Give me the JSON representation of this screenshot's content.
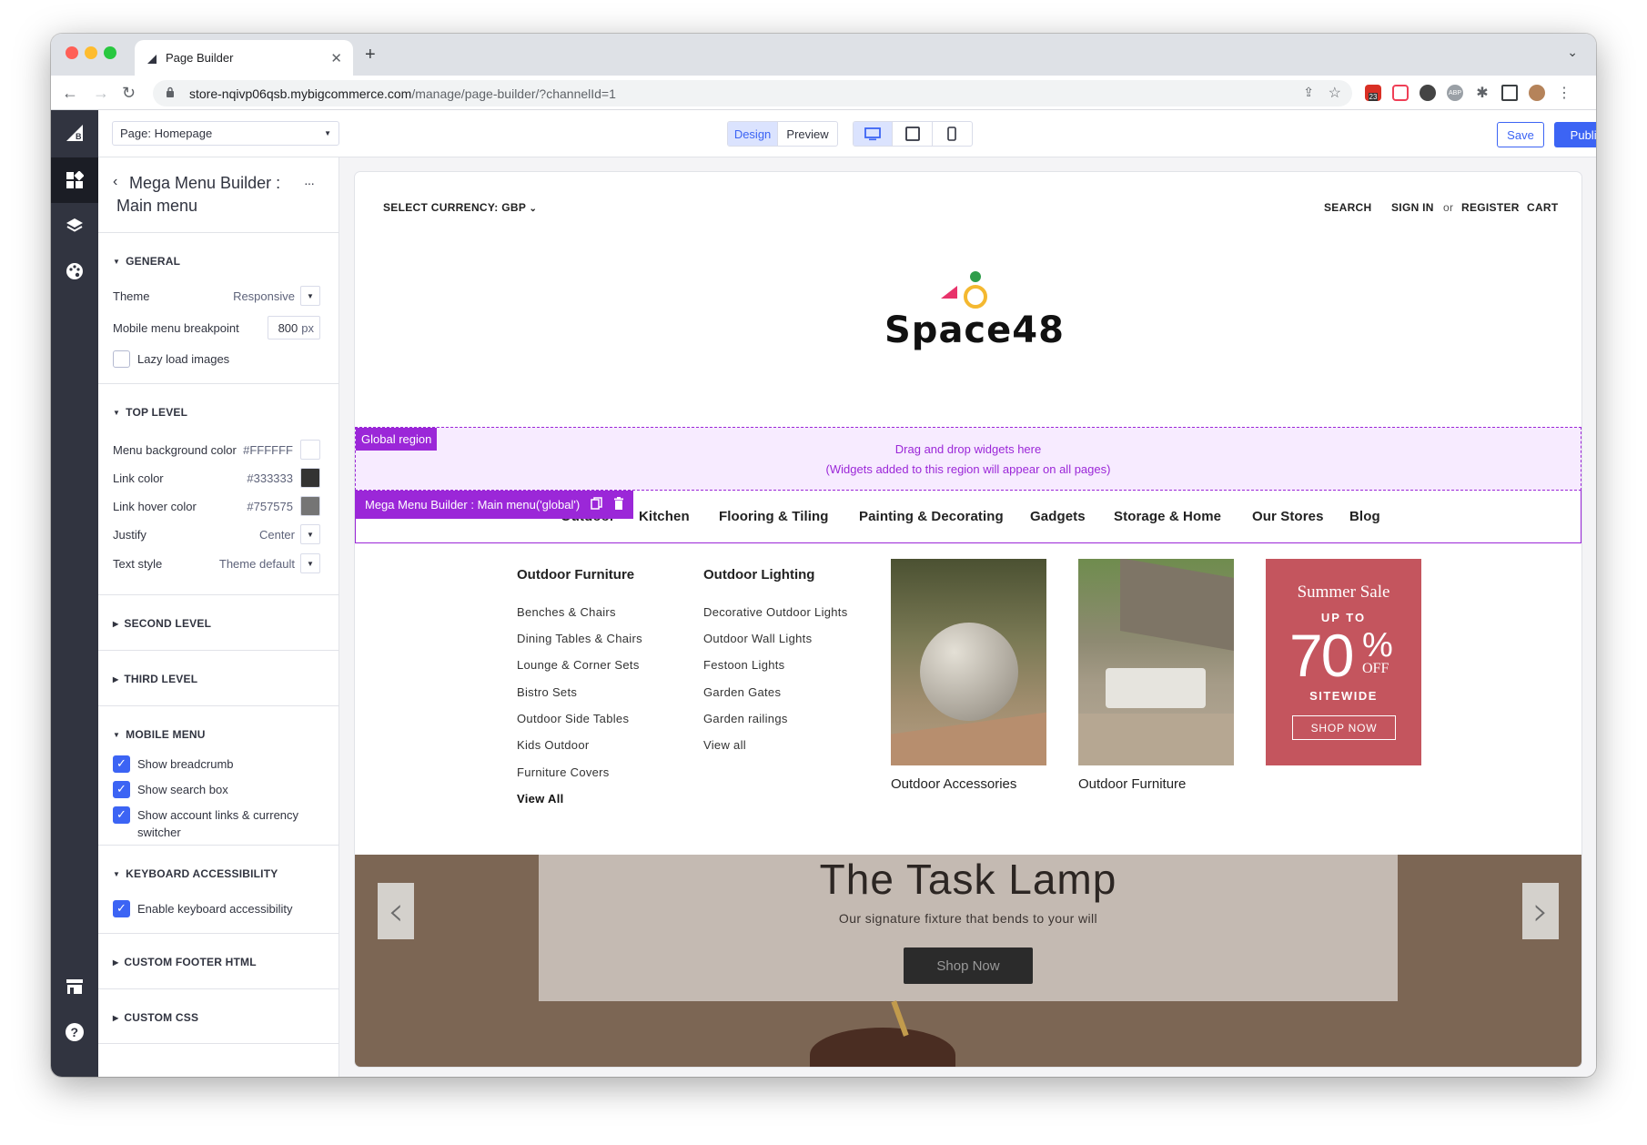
{
  "browser": {
    "tab_title": "Page Builder",
    "url_host": "store-nqivp06qsb.mybigcommerce.com",
    "url_path": "/manage/page-builder/?channelId=1",
    "extension_badge": "23",
    "extension_abp": "ABP"
  },
  "topbar": {
    "page_select": "Page: Homepage",
    "mode_design": "Design",
    "mode_preview": "Preview",
    "save_label": "Save",
    "publish_label": "Publish",
    "accent": "#3c64f4"
  },
  "panel": {
    "back_title_line1": "Mega Menu Builder :",
    "back_title_line2": "Main menu",
    "more": "···",
    "general": {
      "heading": "GENERAL",
      "theme_label": "Theme",
      "theme_value": "Responsive",
      "breakpoint_label": "Mobile menu breakpoint",
      "breakpoint_value": "800",
      "breakpoint_unit": "px",
      "lazy_label": "Lazy load images",
      "lazy_checked": false
    },
    "top_level": {
      "heading": "TOP LEVEL",
      "bg_label": "Menu background color",
      "bg_value": "#FFFFFF",
      "link_label": "Link color",
      "link_value": "#333333",
      "hover_label": "Link hover color",
      "hover_value": "#757575",
      "justify_label": "Justify",
      "justify_value": "Center",
      "text_label": "Text style",
      "text_value": "Theme default"
    },
    "second_level": "SECOND LEVEL",
    "third_level": "THIRD LEVEL",
    "mobile_menu": {
      "heading": "MOBILE MENU",
      "breadcrumb": "Show breadcrumb",
      "search": "Show search box",
      "account_line1": "Show account links & currency",
      "account_line2": "switcher"
    },
    "keyboard": {
      "heading": "KEYBOARD ACCESSIBILITY",
      "enable": "Enable keyboard accessibility"
    },
    "custom_footer": "CUSTOM FOOTER HTML",
    "custom_css": "CUSTOM CSS"
  },
  "store": {
    "currency": "SELECT CURRENCY: GBP",
    "search": "SEARCH",
    "sign_in": "SIGN IN",
    "or": "or",
    "register": "REGISTER",
    "cart": "CART",
    "logo_text": "Space48",
    "global_region_tag": "Global region",
    "global_line1": "Drag and drop widgets here",
    "global_line2": "(Widgets added to this region will appear on all pages)",
    "mega_tag": "Mega Menu Builder : Main menu('global')",
    "nav": [
      "Outdoor",
      "Kitchen",
      "Flooring & Tiling",
      "Painting & Decorating",
      "Gadgets",
      "Storage & Home",
      "Our Stores",
      "Blog"
    ],
    "col1_title": "Outdoor Furniture",
    "col1_links": [
      "Benches & Chairs",
      "Dining Tables & Chairs",
      "Lounge & Corner Sets",
      "Bistro Sets",
      "Outdoor Side Tables",
      "Kids Outdoor",
      "Furniture Covers"
    ],
    "col1_viewall": "View All",
    "col2_title": "Outdoor Lighting",
    "col2_links": [
      "Decorative Outdoor Lights",
      "Outdoor Wall Lights",
      "Festoon Lights",
      "Garden Gates",
      "Garden railings",
      "View all"
    ],
    "card1_caption": "Outdoor Accessories",
    "card2_caption": "Outdoor Furniture",
    "promo": {
      "title": "Summer Sale",
      "upto": "UP TO",
      "big": "70",
      "pct": "%",
      "off": "OFF",
      "sitewide": "SITEWIDE",
      "button": "SHOP NOW",
      "color": "#c4555e"
    },
    "hero_title": "The Task Lamp",
    "hero_sub": "Our signature fixture that bends to your will",
    "hero_button": "Shop Now",
    "region_color": "#9b27d8"
  }
}
